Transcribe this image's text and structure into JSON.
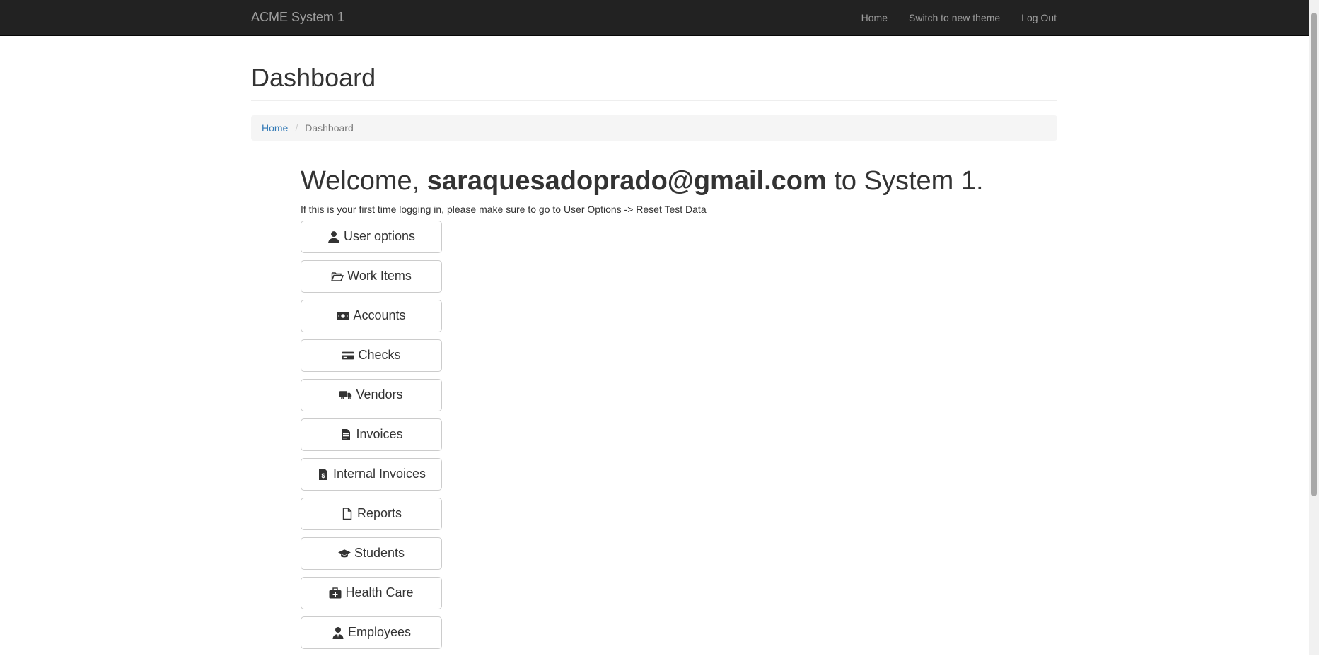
{
  "navbar": {
    "brand": "ACME System 1",
    "links": [
      "Home",
      "Switch to new theme",
      "Log Out"
    ]
  },
  "page": {
    "title": "Dashboard"
  },
  "breadcrumb": {
    "home": "Home",
    "current": "Dashboard"
  },
  "welcome": {
    "prefix": "Welcome, ",
    "email": "saraquesadoprado@gmail.com",
    "suffix": " to System 1.",
    "notice": "If this is your first time logging in, please make sure to go to User Options -> Reset Test Data"
  },
  "menu": [
    {
      "label": "User options",
      "icon": "user-icon"
    },
    {
      "label": "Work Items",
      "icon": "folder-open-icon"
    },
    {
      "label": "Accounts",
      "icon": "money-icon"
    },
    {
      "label": "Checks",
      "icon": "credit-card-icon"
    },
    {
      "label": "Vendors",
      "icon": "truck-icon"
    },
    {
      "label": "Invoices",
      "icon": "file-invoice-icon"
    },
    {
      "label": "Internal Invoices",
      "icon": "file-invoice-dollar-icon"
    },
    {
      "label": "Reports",
      "icon": "file-icon"
    },
    {
      "label": "Students",
      "icon": "graduation-cap-icon"
    },
    {
      "label": "Health Care",
      "icon": "medkit-icon"
    },
    {
      "label": "Employees",
      "icon": "user-tie-icon"
    }
  ]
}
